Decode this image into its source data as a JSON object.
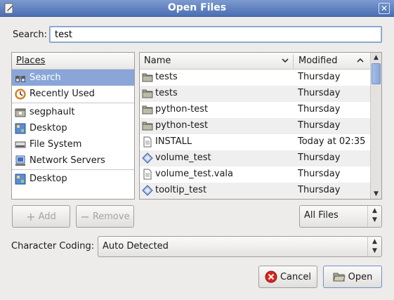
{
  "window": {
    "title": "Open Files"
  },
  "search": {
    "label": "Search:",
    "value": "test"
  },
  "places": {
    "header": "Places",
    "items": [
      {
        "label": "Search",
        "icon": "binoculars-icon",
        "selected": true
      },
      {
        "label": "Recently Used",
        "icon": "clock-icon"
      },
      {
        "label": "segphault",
        "icon": "home-folder-icon"
      },
      {
        "label": "Desktop",
        "icon": "desktop-icon"
      },
      {
        "label": "File System",
        "icon": "drive-icon"
      },
      {
        "label": "Network Servers",
        "icon": "network-icon"
      },
      {
        "label": "Desktop",
        "icon": "desktop-icon"
      }
    ]
  },
  "files": {
    "columns": {
      "name": "Name",
      "modified": "Modified"
    },
    "rows": [
      {
        "name": "tests",
        "modified": "Thursday",
        "icon": "folder-icon"
      },
      {
        "name": "tests",
        "modified": "Thursday",
        "icon": "folder-icon"
      },
      {
        "name": "python-test",
        "modified": "Thursday",
        "icon": "folder-icon"
      },
      {
        "name": "python-test",
        "modified": "Thursday",
        "icon": "folder-icon"
      },
      {
        "name": "INSTALL",
        "modified": "Today at 02:35",
        "icon": "text-file-icon"
      },
      {
        "name": "volume_test",
        "modified": "Thursday",
        "icon": "executable-icon"
      },
      {
        "name": "volume_test.vala",
        "modified": "Thursday",
        "icon": "text-file-icon"
      },
      {
        "name": "tooltip_test",
        "modified": "Thursday",
        "icon": "executable-icon"
      }
    ]
  },
  "buttons": {
    "add": "Add",
    "remove": "Remove",
    "cancel": "Cancel",
    "open": "Open"
  },
  "filter": {
    "value": "All Files"
  },
  "coding": {
    "label": "Character Coding:",
    "value": "Auto Detected"
  }
}
